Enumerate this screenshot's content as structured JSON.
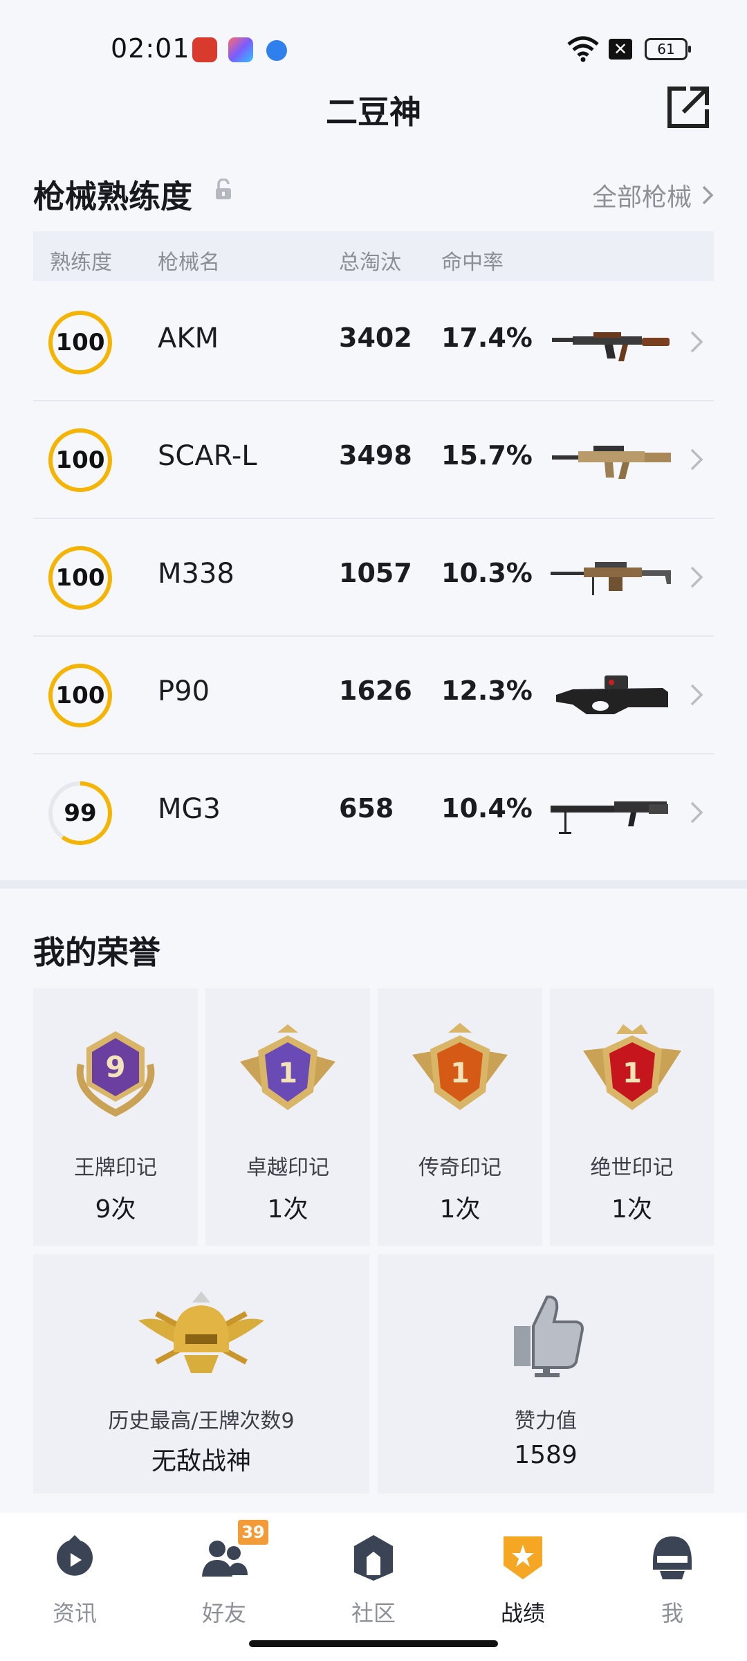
{
  "status": {
    "time": "02:01",
    "battery": "61"
  },
  "header": {
    "title": "二豆神"
  },
  "weapons": {
    "title": "枪械熟练度",
    "all_link": "全部枪械",
    "columns": {
      "proficiency": "熟练度",
      "name": "枪械名",
      "kills": "总淘汰",
      "accuracy": "命中率"
    },
    "rows": [
      {
        "proficiency": "100",
        "level": 1.0,
        "name": "AKM",
        "kills": "3402",
        "accuracy": "17.4%"
      },
      {
        "proficiency": "100",
        "level": 1.0,
        "name": "SCAR-L",
        "kills": "3498",
        "accuracy": "15.7%"
      },
      {
        "proficiency": "100",
        "level": 1.0,
        "name": "M338",
        "kills": "1057",
        "accuracy": "10.3%"
      },
      {
        "proficiency": "100",
        "level": 1.0,
        "name": "P90",
        "kills": "1626",
        "accuracy": "12.3%"
      },
      {
        "proficiency": "99",
        "level": 0.6,
        "name": "MG3",
        "kills": "658",
        "accuracy": "10.4%"
      }
    ]
  },
  "honors": {
    "title": "我的荣誉",
    "marks": [
      {
        "label": "王牌印记",
        "count": "9次",
        "badge_num": "9",
        "color": "#6b3fa0"
      },
      {
        "label": "卓越印记",
        "count": "1次",
        "badge_num": "1",
        "color": "#6a4bb5"
      },
      {
        "label": "传奇印记",
        "count": "1次",
        "badge_num": "1",
        "color": "#d45a16"
      },
      {
        "label": "绝世印记",
        "count": "1次",
        "badge_num": "1",
        "color": "#c4161c"
      }
    ],
    "best": {
      "label": "历史最高/王牌次数9",
      "value": "无敌战神"
    },
    "likes": {
      "label": "赞力值",
      "value": "1589"
    }
  },
  "tabs": [
    {
      "label": "资讯",
      "icon": "news-icon"
    },
    {
      "label": "好友",
      "icon": "friends-icon",
      "badge": "39"
    },
    {
      "label": "社区",
      "icon": "community-icon"
    },
    {
      "label": "战绩",
      "icon": "record-icon",
      "active": true
    },
    {
      "label": "我",
      "icon": "profile-icon"
    }
  ],
  "colors": {
    "accent": "#f5b400",
    "bg": "#f5f7fb"
  }
}
